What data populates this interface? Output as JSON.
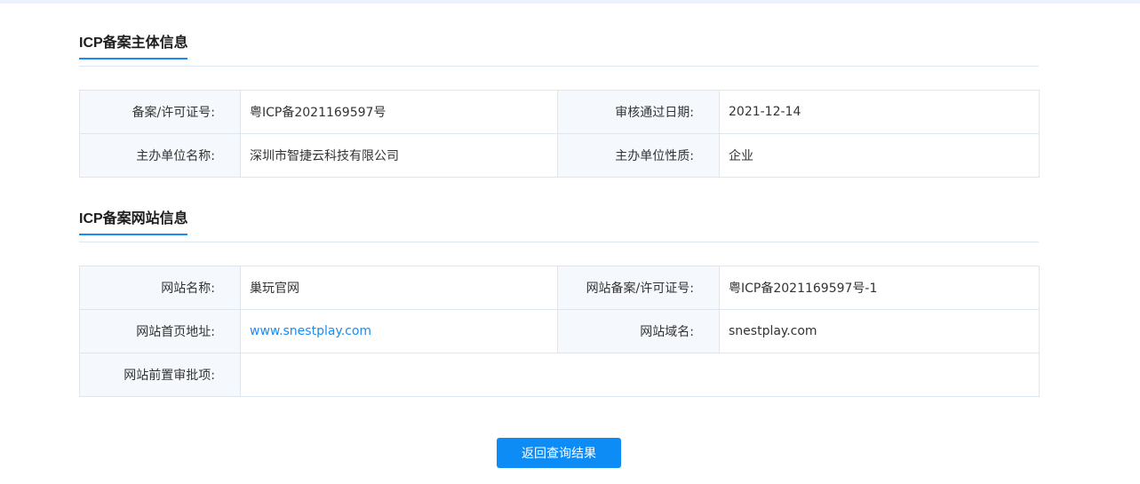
{
  "subject_section": {
    "title": "ICP备案主体信息",
    "rows": [
      [
        {
          "label": "备案/许可证号:",
          "value": "粤ICP备2021169597号"
        },
        {
          "label": "审核通过日期:",
          "value": "2021-12-14"
        }
      ],
      [
        {
          "label": "主办单位名称:",
          "value": "深圳市智捷云科技有限公司"
        },
        {
          "label": "主办单位性质:",
          "value": "企业"
        }
      ]
    ]
  },
  "website_section": {
    "title": "ICP备案网站信息",
    "rows": [
      [
        {
          "label": "网站名称:",
          "value": "巢玩官网"
        },
        {
          "label": "网站备案/许可证号:",
          "value": "粤ICP备2021169597号-1"
        }
      ],
      [
        {
          "label": "网站首页地址:",
          "value": "www.snestplay.com"
        },
        {
          "label": "网站域名:",
          "value": "snestplay.com"
        }
      ],
      [
        {
          "label": "网站前置审批项:",
          "value": ""
        }
      ]
    ]
  },
  "actions": {
    "return_label": "返回查询结果"
  },
  "colors": {
    "accent": "#1a8cf0",
    "button": "#0d8cf5",
    "label_bg": "#f5f9fd",
    "border": "#dde6ef"
  }
}
